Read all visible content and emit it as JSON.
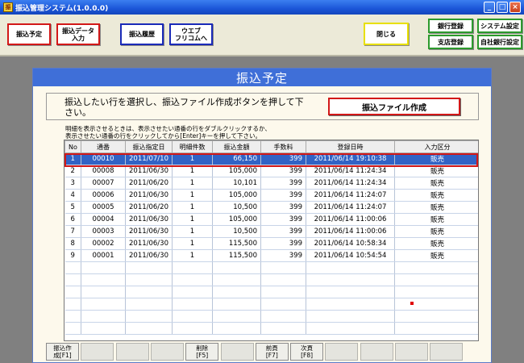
{
  "window": {
    "title": "振込管理システム(1.0.0.0)",
    "min": "_",
    "max": "□",
    "close": "×"
  },
  "toolbar": {
    "schedule": "振込予定",
    "data_entry": "振込データ\n入力",
    "history": "振込履歴",
    "web": "ウエブ\nフリコムへ",
    "close": "閉じる",
    "bank_reg": "銀行登録",
    "system_settings": "システム設定",
    "branch_reg": "支店登録",
    "own_bank": "自社銀行設定"
  },
  "panel": {
    "title": "振込予定",
    "instruction": "振込したい行を選択し、振込ファイル作成ボタンを押して下さい。",
    "create_button": "振込ファイル作成",
    "hint": "明細を表示させるときは、表示させたい通番の行をダブルクリックするか、\n表示させたい通番の行をクリックしてから[Enter]キーを押して下さい。"
  },
  "table": {
    "columns": [
      "No",
      "通番",
      "振込指定日",
      "明細件数",
      "振込金額",
      "手数料",
      "登録日時",
      "入力区分"
    ],
    "rows": [
      [
        "1",
        "00010",
        "2011/07/10",
        "1",
        "66,150",
        "399",
        "2011/06/14 19:10:38",
        "販売"
      ],
      [
        "2",
        "00008",
        "2011/06/30",
        "1",
        "105,000",
        "399",
        "2011/06/14 11:24:34",
        "販売"
      ],
      [
        "3",
        "00007",
        "2011/06/20",
        "1",
        "10,101",
        "399",
        "2011/06/14 11:24:34",
        "販売"
      ],
      [
        "4",
        "00006",
        "2011/06/30",
        "1",
        "105,000",
        "399",
        "2011/06/14 11:24:07",
        "販売"
      ],
      [
        "5",
        "00005",
        "2011/06/20",
        "1",
        "10,500",
        "399",
        "2011/06/14 11:24:07",
        "販売"
      ],
      [
        "6",
        "00004",
        "2011/06/30",
        "1",
        "105,000",
        "399",
        "2011/06/14 11:00:06",
        "販売"
      ],
      [
        "7",
        "00003",
        "2011/06/30",
        "1",
        "10,500",
        "399",
        "2011/06/14 11:00:06",
        "販売"
      ],
      [
        "8",
        "00002",
        "2011/06/30",
        "1",
        "115,500",
        "399",
        "2011/06/14 10:58:34",
        "販売"
      ],
      [
        "9",
        "00001",
        "2011/06/30",
        "1",
        "115,500",
        "399",
        "2011/06/14 10:54:54",
        "販売"
      ]
    ],
    "empty_rows": 6,
    "selected_row": 0
  },
  "fkeys": [
    "振込作\n成[F1]",
    "",
    "",
    "",
    "削除\n[F5]",
    "",
    "前頁\n[F7]",
    "次頁\n[F8]",
    "",
    "",
    "",
    ""
  ]
}
